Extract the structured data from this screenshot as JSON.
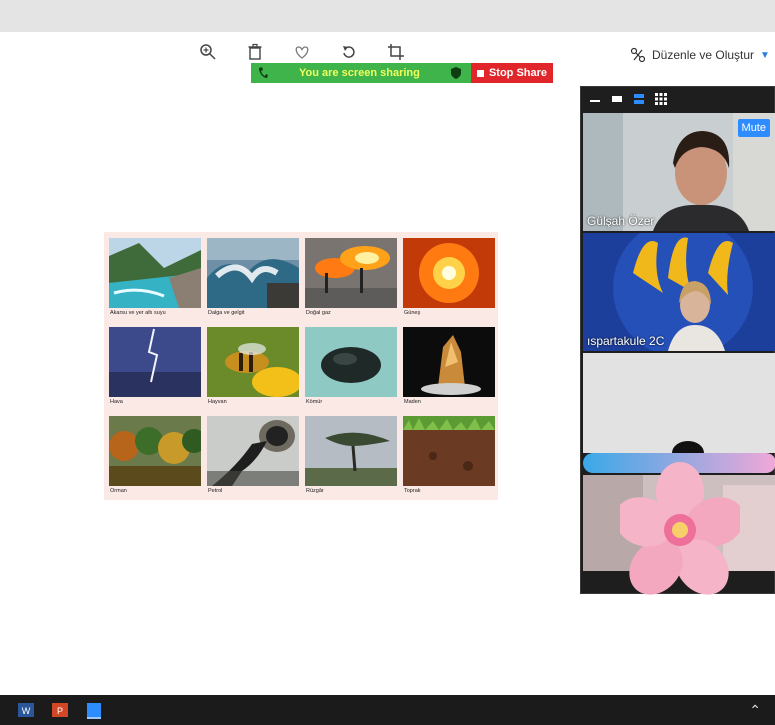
{
  "toolbar": {
    "icons": [
      "zoom-in-icon",
      "trash-icon",
      "heart-icon",
      "rotate-icon",
      "crop-icon"
    ],
    "edit_create_label": "Düzenle ve Oluştur"
  },
  "share_bar": {
    "status_text": "You are screen sharing",
    "stop_label": "Stop Share",
    "colors": {
      "green": "#3fb44a",
      "text": "#f2ff5c",
      "red": "#e0262b"
    }
  },
  "slide": {
    "items": [
      {
        "caption": "Akarsu ve yer altı suyu",
        "icon": "river-photo"
      },
      {
        "caption": "Dalga ve gelgit",
        "icon": "waves-photo"
      },
      {
        "caption": "Doğal gaz",
        "icon": "gas-flare-photo"
      },
      {
        "caption": "Güneş",
        "icon": "sun-photo"
      },
      {
        "caption": "Hava",
        "icon": "lightning-photo"
      },
      {
        "caption": "Hayvan",
        "icon": "bee-photo"
      },
      {
        "caption": "Kömür",
        "icon": "coal-photo"
      },
      {
        "caption": "Maden",
        "icon": "mineral-photo"
      },
      {
        "caption": "Orman",
        "icon": "forest-photo"
      },
      {
        "caption": "Petrol",
        "icon": "oil-pipe-photo"
      },
      {
        "caption": "Rüzgâr",
        "icon": "windy-tree-photo"
      },
      {
        "caption": "Toprak",
        "icon": "soil-photo"
      }
    ]
  },
  "participants_panel": {
    "view_icons": [
      "minimize-icon",
      "speaker-view-icon",
      "active-view-icon",
      "gallery-view-icon"
    ],
    "participants": [
      {
        "name": "Gülşah Özer",
        "mute_label": "Mute"
      },
      {
        "name": "ıspartakule 2C"
      }
    ]
  },
  "taskbar": {
    "apps": [
      "word-icon",
      "powerpoint-icon",
      "zoom-app-icon"
    ]
  }
}
